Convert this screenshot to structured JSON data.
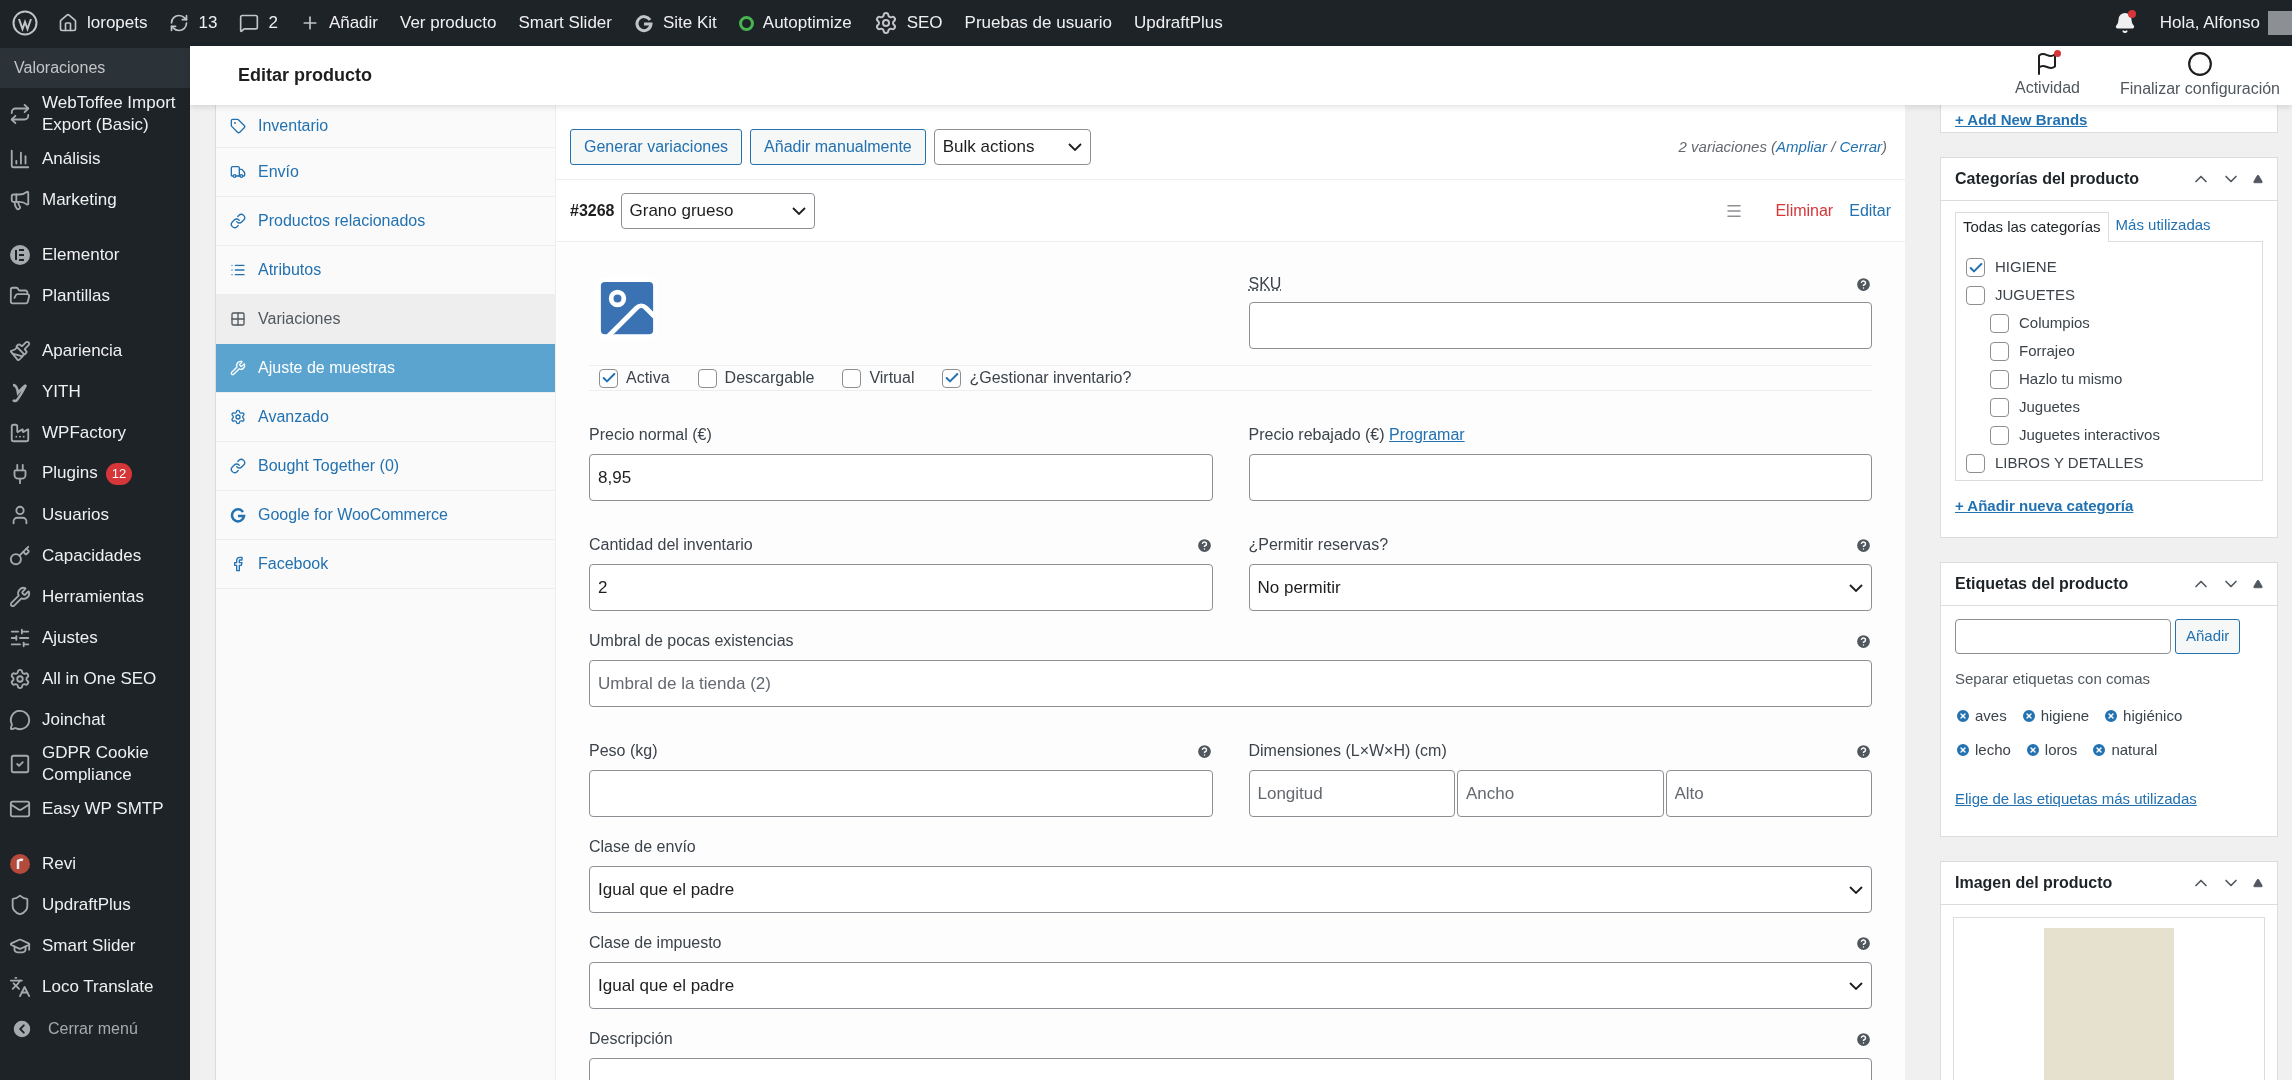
{
  "admin_bar": {
    "items": [
      {
        "label": "loropets"
      },
      {
        "label": "13"
      },
      {
        "label": "2"
      },
      {
        "label": "Añadir"
      },
      {
        "label": "Ver producto"
      },
      {
        "label": "Smart Slider"
      },
      {
        "label": "Site Kit"
      },
      {
        "label": "Autoptimize"
      },
      {
        "label": "SEO"
      },
      {
        "label": "Pruebas de usuario"
      },
      {
        "label": "UpdraftPlus"
      }
    ],
    "notifications_unread": true,
    "greeting": "Hola, Alfonso"
  },
  "header": {
    "title": "Editar producto",
    "actions": [
      {
        "label": "Actividad",
        "unread": true
      },
      {
        "label": "Finalizar configuración",
        "unread": false
      }
    ]
  },
  "sidebar": {
    "current_submenu": "Valoraciones",
    "groups": [
      [
        {
          "label": "WebToffee Import Export (Basic)"
        },
        {
          "label": "Análisis"
        },
        {
          "label": "Marketing"
        }
      ],
      [
        {
          "label": "Elementor"
        },
        {
          "label": "Plantillas"
        }
      ],
      [
        {
          "label": "Apariencia"
        },
        {
          "label": "YITH"
        },
        {
          "label": "WPFactory"
        },
        {
          "label": "Plugins",
          "badge": "12"
        },
        {
          "label": "Usuarios"
        },
        {
          "label": "Capacidades"
        },
        {
          "label": "Herramientas"
        },
        {
          "label": "Ajustes"
        },
        {
          "label": "All in One SEO"
        },
        {
          "label": "Joinchat"
        },
        {
          "label": "GDPR Cookie Compliance"
        },
        {
          "label": "Easy WP SMTP"
        }
      ],
      [
        {
          "label": "Revi"
        },
        {
          "label": "UpdraftPlus"
        },
        {
          "label": "Smart Slider"
        },
        {
          "label": "Loco Translate"
        }
      ]
    ],
    "collapse": "Cerrar menú"
  },
  "product_tabs": [
    {
      "label": "Inventario",
      "selected": false,
      "hovered": false
    },
    {
      "label": "Envío",
      "selected": false,
      "hovered": false
    },
    {
      "label": "Productos relacionados",
      "selected": false,
      "hovered": false
    },
    {
      "label": "Atributos",
      "selected": false,
      "hovered": false
    },
    {
      "label": "Variaciones",
      "selected": true,
      "hovered": false
    },
    {
      "label": "Ajuste de muestras",
      "selected": false,
      "hovered": true
    },
    {
      "label": "Avanzado",
      "selected": false,
      "hovered": false
    },
    {
      "label": "Bought Together (0)",
      "selected": false,
      "hovered": false
    },
    {
      "label": "Google for WooCommerce",
      "selected": false,
      "hovered": false
    },
    {
      "label": "Facebook",
      "selected": false,
      "hovered": false
    }
  ],
  "variations": {
    "buttons": [
      "Generar variaciones",
      "Añadir manualmente"
    ],
    "bulk_actions": "Bulk actions",
    "summary": [
      {
        "kind": "text",
        "text": "2 variaciones ("
      },
      {
        "kind": "link",
        "text": "Ampliar"
      },
      {
        "kind": "text",
        "text": " / "
      },
      {
        "kind": "link",
        "text": "Cerrar"
      },
      {
        "kind": "text",
        "text": ")"
      }
    ],
    "variation": {
      "id": "#3268",
      "attribute": "Grano grueso",
      "actions": [
        {
          "kind": "delete",
          "label": "Eliminar"
        },
        {
          "kind": "edit",
          "label": "Editar"
        }
      ],
      "sku": {
        "label": "SKU",
        "help": true
      },
      "options": [
        {
          "label": "Activa",
          "checked": true
        },
        {
          "label": "Descargable",
          "checked": false
        },
        {
          "label": "Virtual",
          "checked": false
        },
        {
          "label": "¿Gestionar inventario?",
          "checked": true
        }
      ],
      "rows": [
        [
          {
            "kind": "input",
            "label": "Precio normal (€)",
            "value": "8,95",
            "help": false
          },
          {
            "kind": "input",
            "label": "Precio rebajado (€)",
            "link": "Programar",
            "help": false
          }
        ],
        [
          {
            "kind": "input",
            "label": "Cantidad del inventario",
            "value": "2",
            "help": true
          },
          {
            "kind": "select",
            "label": "¿Permitir reservas?",
            "value": "No permitir",
            "help": true
          }
        ],
        [
          {
            "kind": "input",
            "label": "Umbral de pocas existencias",
            "placeholder": "Umbral de la tienda (2)",
            "help": true
          }
        ],
        [
          {
            "kind": "input",
            "label": "Peso (kg)",
            "help": true
          },
          {
            "kind": "dimensions",
            "label": "Dimensiones (L×W×H) (cm)",
            "placeholders": [
              "Longitud",
              "Ancho",
              "Alto"
            ],
            "help": true
          }
        ],
        [
          {
            "kind": "select",
            "label": "Clase de envío",
            "value": "Igual que el padre",
            "help": false
          }
        ],
        [
          {
            "kind": "select",
            "label": "Clase de impuesto",
            "value": "Igual que el padre",
            "help": true
          }
        ],
        [
          {
            "kind": "textarea",
            "label": "Descripción",
            "help": true
          }
        ]
      ]
    }
  },
  "brands": {
    "link": "+ Add New Brands"
  },
  "categories": {
    "title": "Categorías del producto",
    "tabs": [
      {
        "label": "Todas las categorías",
        "selected": true
      },
      {
        "label": "Más utilizadas",
        "selected": false
      }
    ],
    "items": [
      {
        "label": "HIGIENE",
        "checked": true
      },
      {
        "label": "JUGUETES",
        "checked": false,
        "children": [
          {
            "label": "Columpios",
            "checked": false
          },
          {
            "label": "Forrajeo",
            "checked": false
          },
          {
            "label": "Hazlo tu mismo",
            "checked": false
          },
          {
            "label": "Juguetes",
            "checked": false
          },
          {
            "label": "Juguetes interactivos",
            "checked": false
          }
        ]
      },
      {
        "label": "LIBROS Y DETALLES",
        "checked": false
      }
    ],
    "add_link": "+ Añadir nueva categoría"
  },
  "tags": {
    "title": "Etiquetas del producto",
    "button": "Añadir",
    "hint": "Separar etiquetas con comas",
    "tags": [
      "aves",
      "higiene",
      "higiénico",
      "lecho",
      "loros",
      "natural"
    ],
    "link": "Elige de las etiquetas más utilizadas"
  },
  "image": {
    "title": "Imagen del producto"
  }
}
